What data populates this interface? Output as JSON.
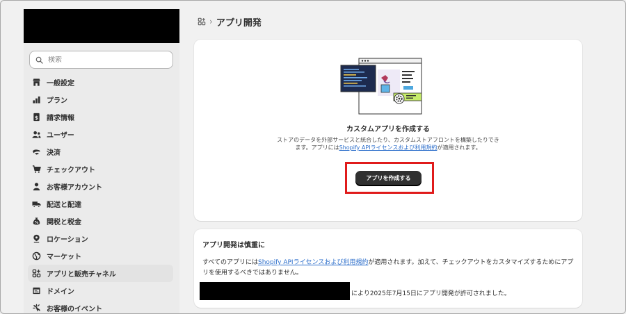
{
  "sidebar": {
    "search": {
      "placeholder": "検索"
    },
    "items": [
      {
        "label": "一般設定",
        "icon": "store-icon"
      },
      {
        "label": "プラン",
        "icon": "plan-icon"
      },
      {
        "label": "請求情報",
        "icon": "billing-icon"
      },
      {
        "label": "ユーザー",
        "icon": "users-icon"
      },
      {
        "label": "決済",
        "icon": "payments-icon"
      },
      {
        "label": "チェックアウト",
        "icon": "cart-icon"
      },
      {
        "label": "お客様アカウント",
        "icon": "person-icon"
      },
      {
        "label": "配送と配達",
        "icon": "truck-icon"
      },
      {
        "label": "関税と税金",
        "icon": "tax-icon"
      },
      {
        "label": "ロケーション",
        "icon": "location-icon"
      },
      {
        "label": "マーケット",
        "icon": "globe-icon"
      },
      {
        "label": "アプリと販売チャネル",
        "icon": "apps-icon",
        "active": true
      },
      {
        "label": "ドメイン",
        "icon": "domain-icon"
      },
      {
        "label": "お客様のイベント",
        "icon": "events-icon"
      }
    ]
  },
  "header": {
    "title": "アプリ開発"
  },
  "main": {
    "empty_title": "カスタムアプリを作成する",
    "desc_pre": "ストアのデータを外部サービスと統合したり、カスタムストアフロントを構築したりできます。アプリには",
    "desc_link": "Shopify APIライセンスおよび利用規約",
    "desc_post": "が適用されます。",
    "create_button": "アプリを作成する",
    "highlight_color": "#e01b1b"
  },
  "warning": {
    "title": "アプリ開発は慎重に",
    "text_pre": "すべてのアプリには",
    "text_link": "Shopify APIライセンスおよび利用規約",
    "text_post": "が適用されます。加えて、チェックアウトをカスタマイズするためにアプリを使用するべきではありません。",
    "permit_text": "により2025年7月15日にアプリ開発が許可されました。"
  },
  "colors": {
    "link": "#2c6ecb",
    "button": "#303030",
    "sidebar_bg": "#ebebeb",
    "page_bg": "#f1f1f1"
  }
}
